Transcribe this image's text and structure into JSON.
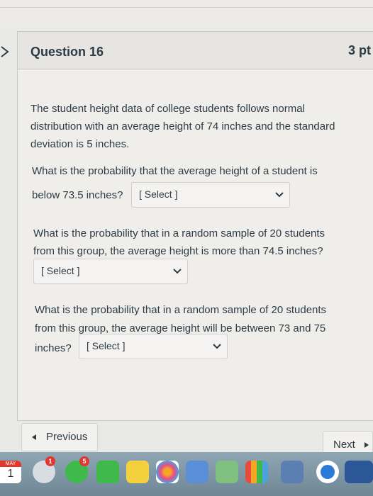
{
  "question": {
    "title": "Question 16",
    "points": "3 pt",
    "intro": [
      "The student height data of college students follows normal",
      "distribution with an average height of 74 inches and the standard",
      "deviation is 5 inches."
    ],
    "part1": {
      "line1": "What is the probability that the average height of a student is",
      "line2": "below 73.5 inches?",
      "select": "[ Select ]"
    },
    "part2": {
      "line1": "What is the probability that in a random sample of 20 students",
      "line2": "from this group, the average height is more than 74.5 inches?",
      "select": "[ Select ]"
    },
    "part3": {
      "line1": "What is the probability that in a random sample of 20 students",
      "line2": "from this group, the average height will be between 73 and 75",
      "line3": "inches?",
      "select": "[ Select ]"
    }
  },
  "nav": {
    "previous": "Previous",
    "next": "Next"
  },
  "dock": {
    "calendar_month": "MAY",
    "calendar_day": "1",
    "badge_messages": "1",
    "badge_facetime": "5"
  },
  "colors": {
    "text": "#2d3b45",
    "card_bg": "#efeeeb",
    "header_bg": "#e6e5e2",
    "border": "#c8c8c4"
  }
}
